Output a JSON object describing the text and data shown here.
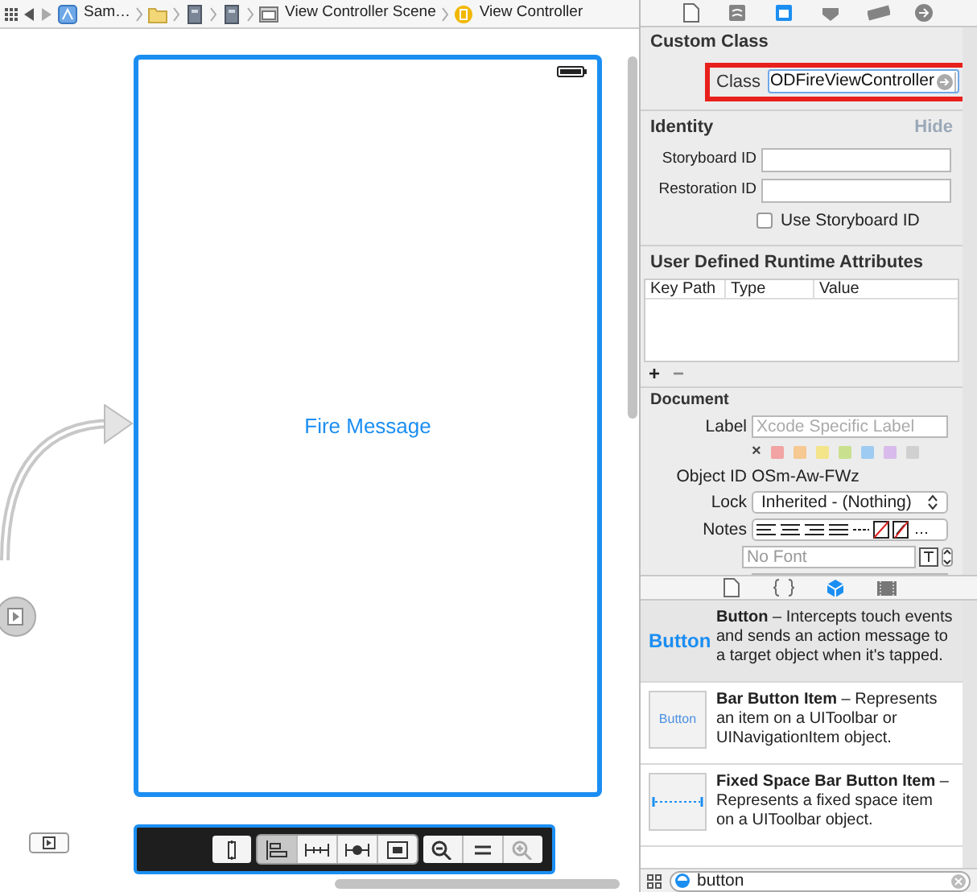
{
  "breadcrumb": [
    {
      "kind": "app",
      "label": "Sam…"
    },
    {
      "kind": "folder"
    },
    {
      "kind": "file"
    },
    {
      "kind": "file"
    },
    {
      "kind": "scene",
      "label": "View Controller Scene"
    },
    {
      "kind": "controller",
      "label": "View Controller"
    }
  ],
  "canvas": {
    "button_title": "Fire Message",
    "selected": true
  },
  "inspector_tabs": [
    {
      "kind": "file",
      "selected": false
    },
    {
      "kind": "help",
      "selected": false
    },
    {
      "kind": "identity",
      "selected": true
    },
    {
      "kind": "attributes",
      "selected": false
    },
    {
      "kind": "size",
      "selected": false
    },
    {
      "kind": "connections",
      "selected": false
    }
  ],
  "custom_class": {
    "title": "Custom Class",
    "class_label": "Class",
    "class_value": "ODFireViewController"
  },
  "identity": {
    "title": "Identity",
    "hide": "Hide",
    "fields": [
      {
        "label": "Storyboard ID"
      },
      {
        "label": "Restoration ID"
      }
    ],
    "checkbox": {
      "label": "Use Storyboard ID",
      "checked": false
    }
  },
  "runtime_attributes": {
    "title": "User Defined Runtime Attributes",
    "columns": [
      "Key Path",
      "Type",
      "Value"
    ],
    "add": "+",
    "remove": "−"
  },
  "document": {
    "title": "Document",
    "label_label": "Label",
    "label_placeholder": "Xcode Specific Label",
    "clear_mark": "×",
    "colors": [
      {
        "color": "#f2a3a3"
      },
      {
        "color": "#f6c892"
      },
      {
        "color": "#f3e48a"
      },
      {
        "color": "#c9e18f"
      },
      {
        "color": "#9ecbf2"
      },
      {
        "color": "#d9bbeb"
      },
      {
        "color": "#d0d0d0"
      }
    ],
    "object_id_label": "Object ID",
    "object_id": "OSm-Aw-FWz",
    "lock_label": "Lock",
    "lock_value": "Inherited - (Nothing)",
    "notes_label": "Notes",
    "font_placeholder": "No Font"
  },
  "library_tabs": [
    {
      "kind": "file",
      "selected": false
    },
    {
      "kind": "code",
      "selected": false
    },
    {
      "kind": "object",
      "selected": true
    },
    {
      "kind": "media",
      "selected": false
    }
  ],
  "library": [
    {
      "kind": "button",
      "preview": "Button",
      "title": "Button",
      "description": "– Intercepts touch events and sends an action message to a target object when it's tapped.",
      "selected": true
    },
    {
      "kind": "bar_button",
      "preview": "Button",
      "title": "Bar Button Item",
      "description": "– Represents an item on a UIToolbar or UINavigationItem object.",
      "selected": false
    },
    {
      "kind": "fixed_space",
      "title": "Fixed Space Bar Button Item",
      "description": "– Represents a fixed space item on a UIToolbar object.",
      "selected": false
    }
  ],
  "search": {
    "value": "button"
  }
}
